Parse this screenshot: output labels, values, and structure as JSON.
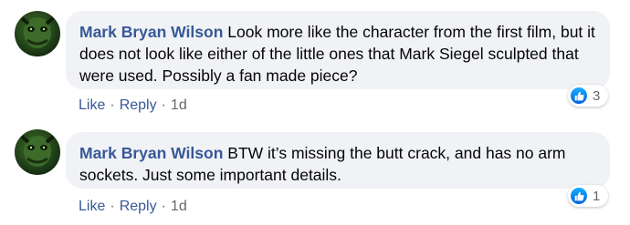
{
  "comments": [
    {
      "author": "Mark Bryan Wilson",
      "text": "Look more like the character from the first film, but it does not look like either of the little ones that Mark Siegel sculpted that were used. Possibly a fan made piece?",
      "reaction_count": "3",
      "like_label": "Like",
      "reply_label": "Reply",
      "separator": "·",
      "time": "1d"
    },
    {
      "author": "Mark Bryan Wilson",
      "text": "BTW it’s missing the butt crack, and has no arm sockets. Just some important details.",
      "reaction_count": "1",
      "like_label": "Like",
      "reply_label": "Reply",
      "separator": "·",
      "time": "1d"
    }
  ],
  "colors": {
    "author_link": "#385898",
    "bubble_bg": "#f0f2f5",
    "like_blue": "#1877f2",
    "meta_gray": "#65676b"
  },
  "icons": {
    "avatar": "profile-avatar",
    "reaction": "like-thumbs-up-icon"
  }
}
